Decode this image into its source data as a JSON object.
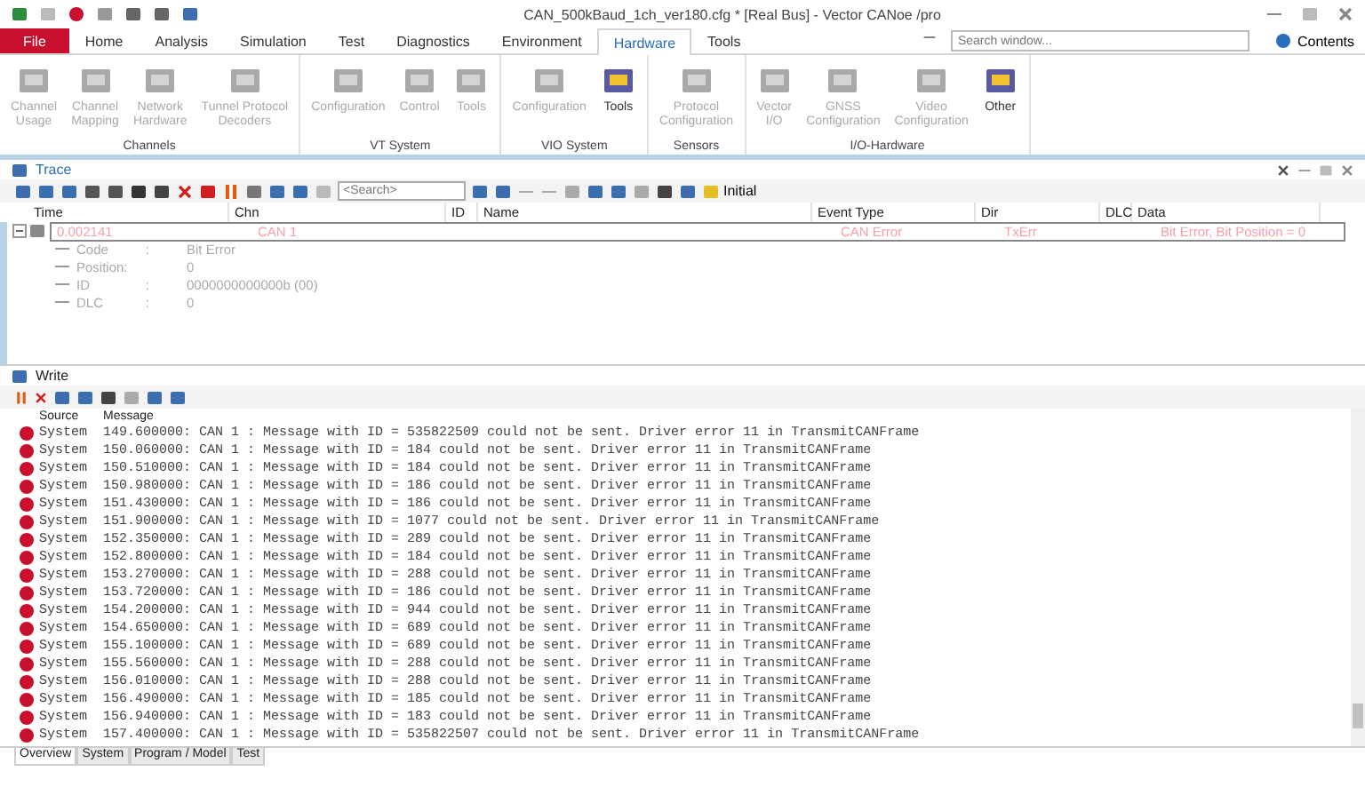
{
  "window": {
    "title": "CAN_500kBaud_1ch_ver180.cfg * [Real Bus] - Vector CANoe /pro"
  },
  "ribbon_tabs": [
    {
      "label": "File",
      "kind": "file",
      "selected": false
    },
    {
      "label": "Home",
      "kind": "tab",
      "selected": false
    },
    {
      "label": "Analysis",
      "kind": "tab",
      "selected": false
    },
    {
      "label": "Simulation",
      "kind": "tab",
      "selected": false
    },
    {
      "label": "Test",
      "kind": "tab",
      "selected": false
    },
    {
      "label": "Diagnostics",
      "kind": "tab",
      "selected": false
    },
    {
      "label": "Environment",
      "kind": "tab",
      "selected": false
    },
    {
      "label": "Hardware",
      "kind": "tab",
      "selected": true
    },
    {
      "label": "Tools",
      "kind": "tab",
      "selected": false
    }
  ],
  "search": {
    "placeholder": "Search window..."
  },
  "help": {
    "label": "Contents"
  },
  "ribbon_groups": [
    {
      "name": "Channels",
      "buttons": [
        {
          "label": "Channel\nUsage",
          "disabled": true
        },
        {
          "label": "Channel\nMapping",
          "disabled": true
        },
        {
          "label": "Network\nHardware",
          "disabled": true
        },
        {
          "label": "Tunnel Protocol\nDecoders",
          "disabled": true
        }
      ]
    },
    {
      "name": "VT System",
      "buttons": [
        {
          "label": "Configuration",
          "disabled": true
        },
        {
          "label": "Control",
          "disabled": true
        },
        {
          "label": "Tools",
          "disabled": true
        }
      ]
    },
    {
      "name": "VIO System",
      "buttons": [
        {
          "label": "Configuration",
          "disabled": true
        },
        {
          "label": "Tools",
          "disabled": false
        }
      ]
    },
    {
      "name": "Sensors",
      "buttons": [
        {
          "label": "Protocol\nConfiguration",
          "disabled": true
        }
      ]
    },
    {
      "name": "I/O-Hardware",
      "buttons": [
        {
          "label": "Vector\nI/O",
          "disabled": true
        },
        {
          "label": "GNSS\nConfiguration",
          "disabled": true
        },
        {
          "label": "Video\nConfiguration",
          "disabled": true
        },
        {
          "label": "Other",
          "disabled": false
        }
      ]
    }
  ],
  "trace": {
    "title": "Trace",
    "search": {
      "placeholder": "<Search>"
    },
    "filter": {
      "label": "Initial"
    },
    "columns": [
      "Time",
      "Chn",
      "ID",
      "Name",
      "Event Type",
      "Dir",
      "DLC",
      "Data"
    ],
    "rows": [
      {
        "time": "0.002141",
        "chn": "CAN 1",
        "event_type": "CAN Error",
        "dir": "TxErr",
        "data": "Bit Error, Bit Position = 0",
        "expanded": true,
        "fields": [
          {
            "label": "Code",
            "colon": ":",
            "value": "Bit Error"
          },
          {
            "label": "Position:",
            "value": "0"
          },
          {
            "label": "ID",
            "colon": ":",
            "value": "0000000000000b (00)"
          },
          {
            "label": "DLC",
            "colon": ":",
            "value": "0"
          }
        ]
      }
    ]
  },
  "write": {
    "title": "Write",
    "columns": [
      "Source",
      "Message"
    ],
    "rows": [
      {
        "source": "System",
        "message": "149.600000: CAN 1 : Message with ID = 535822509 could not be sent. Driver error 11 in TransmitCANFrame"
      },
      {
        "source": "System",
        "message": "150.060000: CAN 1 : Message with ID = 184 could not be sent. Driver error 11 in TransmitCANFrame"
      },
      {
        "source": "System",
        "message": "150.510000: CAN 1 : Message with ID = 184 could not be sent. Driver error 11 in TransmitCANFrame"
      },
      {
        "source": "System",
        "message": "150.980000: CAN 1 : Message with ID = 186 could not be sent. Driver error 11 in TransmitCANFrame"
      },
      {
        "source": "System",
        "message": "151.430000: CAN 1 : Message with ID = 186 could not be sent. Driver error 11 in TransmitCANFrame"
      },
      {
        "source": "System",
        "message": "151.900000: CAN 1 : Message with ID = 1077 could not be sent. Driver error 11 in TransmitCANFrame"
      },
      {
        "source": "System",
        "message": "152.350000: CAN 1 : Message with ID = 289 could not be sent. Driver error 11 in TransmitCANFrame"
      },
      {
        "source": "System",
        "message": "152.800000: CAN 1 : Message with ID = 184 could not be sent. Driver error 11 in TransmitCANFrame"
      },
      {
        "source": "System",
        "message": "153.270000: CAN 1 : Message with ID = 288 could not be sent. Driver error 11 in TransmitCANFrame"
      },
      {
        "source": "System",
        "message": "153.720000: CAN 1 : Message with ID = 186 could not be sent. Driver error 11 in TransmitCANFrame"
      },
      {
        "source": "System",
        "message": "154.200000: CAN 1 : Message with ID = 944 could not be sent. Driver error 11 in TransmitCANFrame"
      },
      {
        "source": "System",
        "message": "154.650000: CAN 1 : Message with ID = 689 could not be sent. Driver error 11 in TransmitCANFrame"
      },
      {
        "source": "System",
        "message": "155.100000: CAN 1 : Message with ID = 689 could not be sent. Driver error 11 in TransmitCANFrame"
      },
      {
        "source": "System",
        "message": "155.560000: CAN 1 : Message with ID = 288 could not be sent. Driver error 11 in TransmitCANFrame"
      },
      {
        "source": "System",
        "message": "156.010000: CAN 1 : Message with ID = 288 could not be sent. Driver error 11 in TransmitCANFrame"
      },
      {
        "source": "System",
        "message": "156.490000: CAN 1 : Message with ID = 185 could not be sent. Driver error 11 in TransmitCANFrame"
      },
      {
        "source": "System",
        "message": "156.940000: CAN 1 : Message with ID = 183 could not be sent. Driver error 11 in TransmitCANFrame"
      },
      {
        "source": "System",
        "message": "157.400000: CAN 1 : Message with ID = 535822507 could not be sent. Driver error 11 in TransmitCANFrame"
      }
    ]
  },
  "bottom_tabs": [
    {
      "label": "Overview",
      "selected": true
    },
    {
      "label": "System",
      "selected": false
    },
    {
      "label": "Program / Model",
      "selected": false
    },
    {
      "label": "Test",
      "selected": false
    }
  ]
}
